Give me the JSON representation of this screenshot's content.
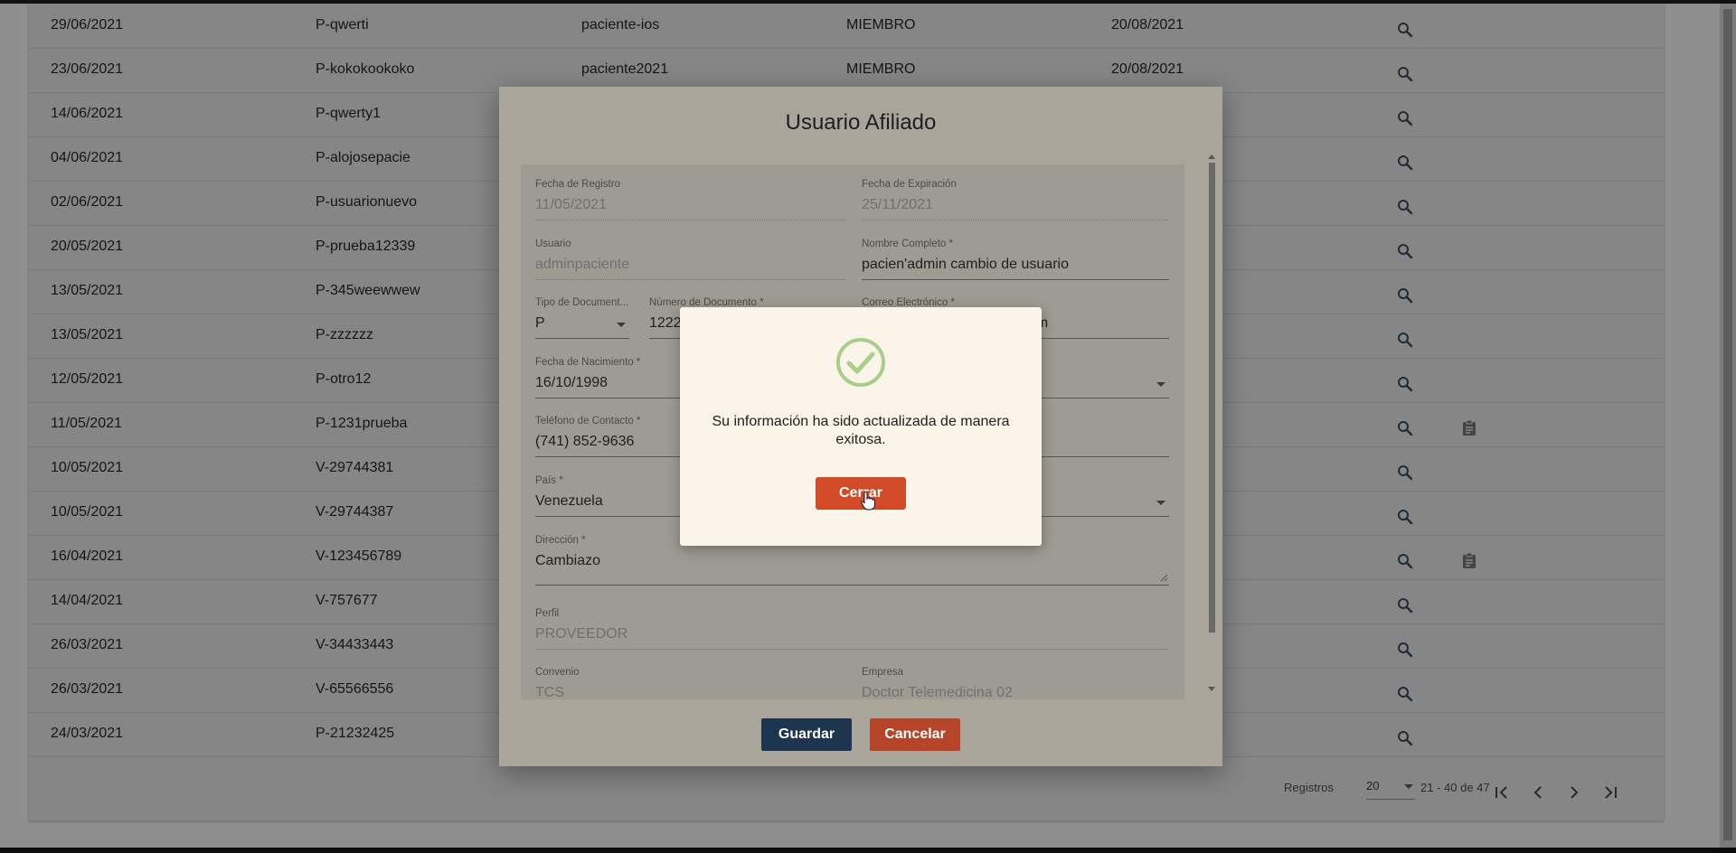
{
  "table": {
    "rows": [
      {
        "fecha": "29/06/2021",
        "usuario": "P-qwerti",
        "perfil_usuario": "paciente-ios",
        "tipo": "MIEMBRO",
        "vence": "20/08/2021",
        "icons": [
          "search-icon"
        ]
      },
      {
        "fecha": "23/06/2021",
        "usuario": "P-kokokookoko",
        "perfil_usuario": "paciente2021",
        "tipo": "MIEMBRO",
        "vence": "20/08/2021",
        "icons": [
          "search-icon"
        ]
      },
      {
        "fecha": "14/06/2021",
        "usuario": "P-qwerty1",
        "perfil_usuario": "",
        "tipo": "",
        "vence": "",
        "icons": [
          "search-icon"
        ]
      },
      {
        "fecha": "04/06/2021",
        "usuario": "P-alojosepacie",
        "perfil_usuario": "",
        "tipo": "",
        "vence": "",
        "icons": [
          "search-icon"
        ]
      },
      {
        "fecha": "02/06/2021",
        "usuario": "P-usuarionuevo",
        "perfil_usuario": "",
        "tipo": "",
        "vence": "",
        "icons": [
          "search-icon"
        ]
      },
      {
        "fecha": "20/05/2021",
        "usuario": "P-prueba12339",
        "perfil_usuario": "",
        "tipo": "",
        "vence": "",
        "icons": [
          "search-icon"
        ]
      },
      {
        "fecha": "13/05/2021",
        "usuario": "P-345weewwew",
        "perfil_usuario": "",
        "tipo": "",
        "vence": "",
        "icons": [
          "search-icon"
        ]
      },
      {
        "fecha": "13/05/2021",
        "usuario": "P-zzzzzz",
        "perfil_usuario": "",
        "tipo": "",
        "vence": "",
        "icons": [
          "search-icon"
        ]
      },
      {
        "fecha": "12/05/2021",
        "usuario": "P-otro12",
        "perfil_usuario": "",
        "tipo": "",
        "vence": "",
        "icons": [
          "search-icon"
        ]
      },
      {
        "fecha": "11/05/2021",
        "usuario": "P-1231prueba",
        "perfil_usuario": "",
        "tipo": "",
        "vence": "",
        "icons": [
          "search-icon",
          "clipboard-icon"
        ]
      },
      {
        "fecha": "10/05/2021",
        "usuario": "V-29744381",
        "perfil_usuario": "",
        "tipo": "",
        "vence": "",
        "icons": [
          "search-icon"
        ]
      },
      {
        "fecha": "10/05/2021",
        "usuario": "V-29744387",
        "perfil_usuario": "",
        "tipo": "",
        "vence": "",
        "icons": [
          "search-icon"
        ]
      },
      {
        "fecha": "16/04/2021",
        "usuario": "V-123456789",
        "perfil_usuario": "",
        "tipo": "",
        "vence": "",
        "icons": [
          "search-icon",
          "clipboard-icon"
        ]
      },
      {
        "fecha": "14/04/2021",
        "usuario": "V-757677",
        "perfil_usuario": "",
        "tipo": "",
        "vence": "",
        "icons": [
          "search-icon"
        ]
      },
      {
        "fecha": "26/03/2021",
        "usuario": "V-34433443",
        "perfil_usuario": "",
        "tipo": "",
        "vence": "",
        "icons": [
          "search-icon"
        ]
      },
      {
        "fecha": "26/03/2021",
        "usuario": "V-65566556",
        "perfil_usuario": "",
        "tipo": "",
        "vence": "",
        "icons": [
          "search-icon"
        ]
      },
      {
        "fecha": "24/03/2021",
        "usuario": "P-21232425",
        "perfil_usuario": "",
        "tipo": "",
        "vence": "",
        "icons": [
          "search-icon"
        ]
      }
    ]
  },
  "paginator": {
    "label": "Registros",
    "page_size": "20",
    "range": "21 - 40 de 47"
  },
  "modal": {
    "title": "Usuario Afiliado",
    "fields": {
      "fecha_registro": {
        "label": "Fecha de Registro",
        "value": "11/05/2021"
      },
      "fecha_expiracion": {
        "label": "Fecha de Expiración",
        "value": "25/11/2021"
      },
      "usuario": {
        "label": "Usuario",
        "value": "adminpaciente"
      },
      "nombre_completo": {
        "label": "Nombre Completo *",
        "value": "pacien'admin cambio de usuario"
      },
      "tipo_documento": {
        "label": "Tipo de Document...",
        "value": "P"
      },
      "numero_documento": {
        "label": "Número de Documento *",
        "value": "1222"
      },
      "correo": {
        "label": "Correo Electrónico *",
        "value": "om"
      },
      "fecha_nacimiento": {
        "label": "Fecha de Nacimiento *",
        "value": "16/10/1998"
      },
      "telefono": {
        "label": "Teléfono de Contacto *",
        "value": "(741) 852-9636"
      },
      "pais": {
        "label": "País *",
        "value": "Venezuela"
      },
      "direccion": {
        "label": "Dirección *",
        "value": "Cambiazo"
      },
      "perfil": {
        "label": "Perfil",
        "value": "PROVEEDOR"
      },
      "convenio": {
        "label": "Convenio",
        "value": "TCS"
      },
      "empresa": {
        "label": "Empresa",
        "value": "Doctor Telemedicina 02"
      }
    },
    "guardar_label": "Guardar",
    "cancelar_label": "Cancelar"
  },
  "dialog": {
    "icon": "check-circle-icon",
    "message": "Su información ha sido actualizada de manera exitosa.",
    "close_label": "Cerrar"
  },
  "colors": {
    "accent_red": "#d14b28",
    "primary_navy": "#1e3550",
    "success_green": "#a7cf8a"
  }
}
